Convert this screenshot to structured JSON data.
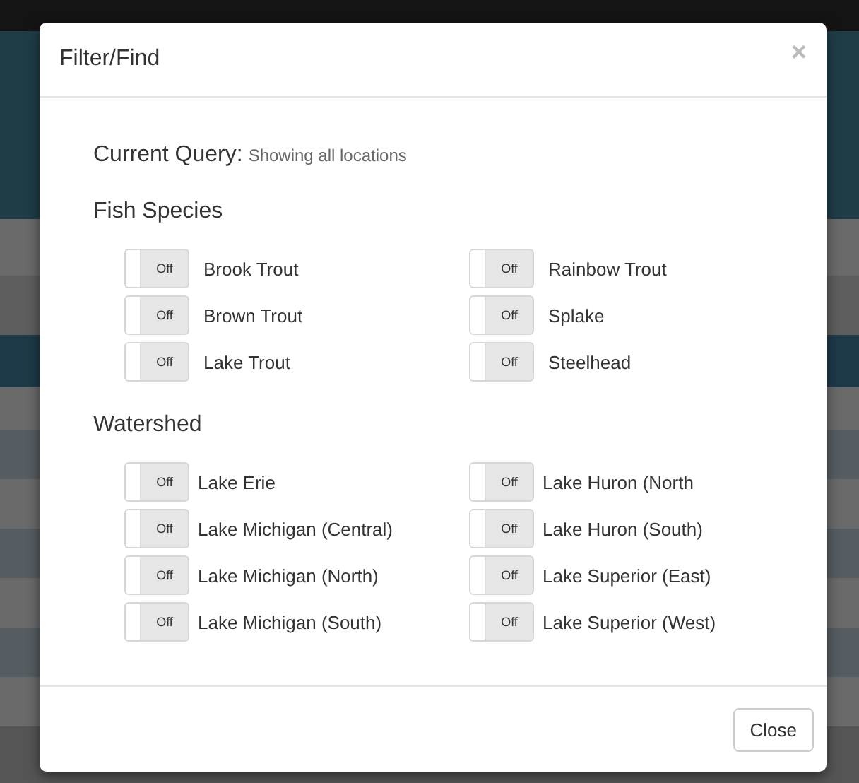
{
  "modal": {
    "title": "Filter/Find",
    "close_icon": "×",
    "query": {
      "label": "Current Query:",
      "value": "Showing all locations"
    },
    "sections": [
      {
        "heading": "Fish Species",
        "items": [
          {
            "label": "Brook Trout",
            "state": "Off",
            "on": false
          },
          {
            "label": "Rainbow Trout",
            "state": "Off",
            "on": false
          },
          {
            "label": "Brown Trout",
            "state": "Off",
            "on": false
          },
          {
            "label": "Splake",
            "state": "Off",
            "on": false
          },
          {
            "label": "Lake Trout",
            "state": "Off",
            "on": false
          },
          {
            "label": "Steelhead",
            "state": "Off",
            "on": false
          }
        ]
      },
      {
        "heading": "Watershed",
        "items": [
          {
            "label": "Lake Erie",
            "state": "Off",
            "on": false
          },
          {
            "label": "Lake Huron (North",
            "state": "Off",
            "on": false
          },
          {
            "label": "Lake Michigan (Central)",
            "state": "Off",
            "on": false
          },
          {
            "label": "Lake Huron (South)",
            "state": "Off",
            "on": false
          },
          {
            "label": "Lake Michigan (North)",
            "state": "Off",
            "on": false
          },
          {
            "label": "Lake Superior (East)",
            "state": "Off",
            "on": false
          },
          {
            "label": "Lake Michigan (South)",
            "state": "Off",
            "on": false
          },
          {
            "label": "Lake Superior (West)",
            "state": "Off",
            "on": false
          }
        ]
      }
    ],
    "close_button": "Close"
  }
}
